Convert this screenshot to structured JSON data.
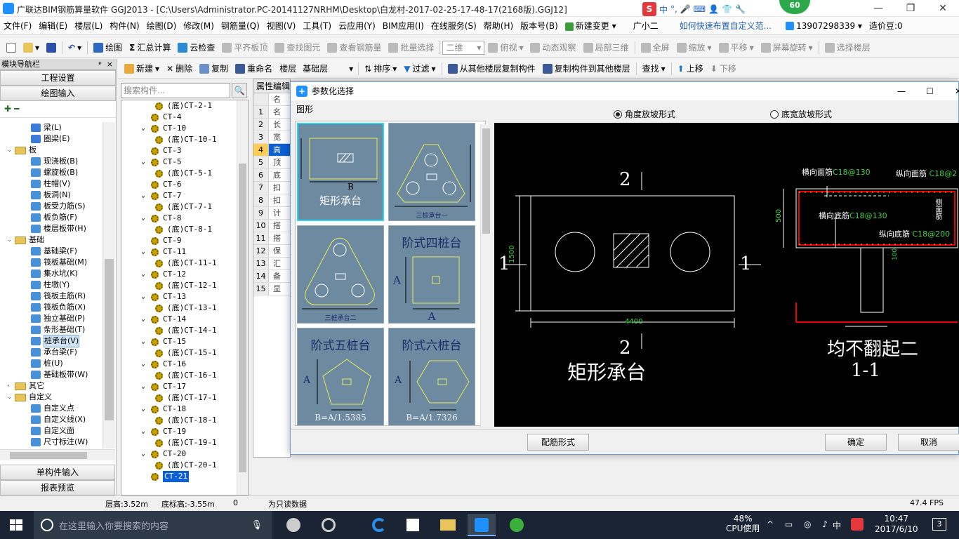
{
  "titlebar": {
    "title": "广联达BIM钢筋算量软件 GGJ2013 - [C:\\Users\\Administrator.PC-20141127NRHM\\Desktop\\白龙村-2017-02-25-17-48-17(2168版).GGJ12]",
    "ime": [
      "中",
      "°,",
      "🎤",
      "⌨",
      "👤",
      "👕",
      "🔧"
    ],
    "ime_badge": "S",
    "badge": "60",
    "min": "—",
    "max": "❐",
    "close": "✕"
  },
  "menus": [
    "文件(F)",
    "编辑(E)",
    "楼层(L)",
    "构件(N)",
    "绘图(D)",
    "修改(M)",
    "钢筋量(Q)",
    "视图(V)",
    "工具(T)",
    "云应用(Y)",
    "BIM应用(I)",
    "在线服务(S)",
    "帮助(H)",
    "版本号(B)",
    "新建变更",
    "广小二",
    "如何快速布置自定义范...",
    "13907298339",
    "造价豆:0"
  ],
  "toolbar1": {
    "items": [
      "绘图",
      "汇总计算",
      "云检查",
      "平齐板顶",
      "查找图元",
      "查看钢筋量",
      "批量选择"
    ],
    "view_combo": "二维",
    "view_items": [
      "俯视",
      "动态观察",
      "局部三维",
      "全屏",
      "缩放",
      "平移",
      "屏幕旋转",
      "选择楼层"
    ],
    "sigma": "Σ"
  },
  "toolbar2": {
    "items": [
      "新建",
      "删除",
      "复制",
      "重命名",
      "楼层",
      "排序",
      "过滤",
      "从其他楼层复制构件",
      "复制构件到其他楼层",
      "查找",
      "上移",
      "下移"
    ],
    "floor_combo": "基础层"
  },
  "nav": {
    "header": "模块导航栏",
    "pin": "ᵖ",
    "close": "×",
    "btn_setup": "工程设置",
    "btn_draw": "绘图输入",
    "btn_single": "单构件输入",
    "btn_report": "报表预览",
    "tools": "+ -",
    "tree": [
      {
        "t": "梁(L)",
        "lvl": 2,
        "c": "#3a7bd5"
      },
      {
        "t": "圈梁(E)",
        "lvl": 2,
        "c": "#3a7bd5"
      },
      {
        "t": "板",
        "lvl": 1,
        "fold": true,
        "exp": "⌄"
      },
      {
        "t": "现浇板(B)",
        "lvl": 2,
        "c": "#4a90d9"
      },
      {
        "t": "螺旋板(B)",
        "lvl": 2,
        "c": "#4a90d9"
      },
      {
        "t": "柱帽(V)",
        "lvl": 2,
        "c": "#4a90d9"
      },
      {
        "t": "板洞(N)",
        "lvl": 2,
        "c": "#4a90d9"
      },
      {
        "t": "板受力筋(S)",
        "lvl": 2,
        "c": "#4a90d9"
      },
      {
        "t": "板负筋(F)",
        "lvl": 2,
        "c": "#4a90d9"
      },
      {
        "t": "楼层板带(H)",
        "lvl": 2,
        "c": "#4a90d9"
      },
      {
        "t": "基础",
        "lvl": 1,
        "fold": true,
        "exp": "⌄"
      },
      {
        "t": "基础梁(F)",
        "lvl": 2,
        "c": "#4a90d9"
      },
      {
        "t": "筏板基础(M)",
        "lvl": 2,
        "c": "#4a90d9"
      },
      {
        "t": "集水坑(K)",
        "lvl": 2,
        "c": "#4a90d9"
      },
      {
        "t": "柱墩(Y)",
        "lvl": 2,
        "c": "#4a90d9"
      },
      {
        "t": "筏板主筋(R)",
        "lvl": 2,
        "c": "#4a90d9"
      },
      {
        "t": "筏板负筋(X)",
        "lvl": 2,
        "c": "#4a90d9"
      },
      {
        "t": "独立基础(P)",
        "lvl": 2,
        "c": "#4a90d9"
      },
      {
        "t": "条形基础(T)",
        "lvl": 2,
        "c": "#4a90d9"
      },
      {
        "t": "桩承台(V)",
        "lvl": 2,
        "c": "#4a90d9",
        "sel": true
      },
      {
        "t": "承台梁(F)",
        "lvl": 2,
        "c": "#4a90d9"
      },
      {
        "t": "桩(U)",
        "lvl": 2,
        "c": "#4a90d9"
      },
      {
        "t": "基础板带(W)",
        "lvl": 2,
        "c": "#4a90d9"
      },
      {
        "t": "其它",
        "lvl": 1,
        "fold": true,
        "exp": "›"
      },
      {
        "t": "自定义",
        "lvl": 1,
        "fold": true,
        "exp": "⌄"
      },
      {
        "t": "自定义点",
        "lvl": 2,
        "c": "#4a90d9"
      },
      {
        "t": "自定义线(X)",
        "lvl": 2,
        "c": "#4a90d9"
      },
      {
        "t": "自定义面",
        "lvl": 2,
        "c": "#4a90d9"
      },
      {
        "t": "尺寸标注(W)",
        "lvl": 2,
        "c": "#4a90d9"
      }
    ]
  },
  "search": {
    "placeholder": "搜索构件...",
    "icon": "🔍"
  },
  "components": [
    {
      "t": "(底)CT-2-1",
      "sub": true
    },
    {
      "t": "CT-4"
    },
    {
      "t": "CT-10",
      "exp": true
    },
    {
      "t": "(底)CT-10-1",
      "sub": true
    },
    {
      "t": "CT-3"
    },
    {
      "t": "CT-5",
      "exp": true
    },
    {
      "t": "(底)CT-5-1",
      "sub": true
    },
    {
      "t": "CT-6"
    },
    {
      "t": "CT-7",
      "exp": true
    },
    {
      "t": "(底)CT-7-1",
      "sub": true
    },
    {
      "t": "CT-8",
      "exp": true
    },
    {
      "t": "(底)CT-8-1",
      "sub": true
    },
    {
      "t": "CT-9"
    },
    {
      "t": "CT-11",
      "exp": true
    },
    {
      "t": "(底)CT-11-1",
      "sub": true
    },
    {
      "t": "CT-12",
      "exp": true
    },
    {
      "t": "(底)CT-12-1",
      "sub": true
    },
    {
      "t": "CT-13",
      "exp": true
    },
    {
      "t": "(底)CT-13-1",
      "sub": true
    },
    {
      "t": "CT-14",
      "exp": true
    },
    {
      "t": "(底)CT-14-1",
      "sub": true
    },
    {
      "t": "CT-15",
      "exp": true
    },
    {
      "t": "(底)CT-15-1",
      "sub": true
    },
    {
      "t": "CT-16",
      "exp": true
    },
    {
      "t": "(底)CT-16-1",
      "sub": true
    },
    {
      "t": "CT-17",
      "exp": true
    },
    {
      "t": "(底)CT-17-1",
      "sub": true
    },
    {
      "t": "CT-18",
      "exp": true
    },
    {
      "t": "(底)CT-18-1",
      "sub": true
    },
    {
      "t": "CT-19",
      "exp": true
    },
    {
      "t": "(底)CT-19-1",
      "sub": true
    },
    {
      "t": "CT-20",
      "exp": true
    },
    {
      "t": "(底)CT-20-1",
      "sub": true
    },
    {
      "t": "CT-21",
      "sel": true
    }
  ],
  "props": {
    "header": "属性编辑",
    "rows": [
      {
        "n": "",
        "v": "名"
      },
      {
        "n": "1",
        "v": "名"
      },
      {
        "n": "2",
        "v": "长"
      },
      {
        "n": "3",
        "v": "宽"
      },
      {
        "n": "4",
        "v": "高",
        "sel": true
      },
      {
        "n": "5",
        "v": "顶"
      },
      {
        "n": "6",
        "v": "底"
      },
      {
        "n": "7",
        "v": "扣"
      },
      {
        "n": "8",
        "v": "扣"
      },
      {
        "n": "9",
        "v": "计"
      },
      {
        "n": "10",
        "v": "搭"
      },
      {
        "n": "11",
        "v": "搭"
      },
      {
        "n": "12",
        "v": "保"
      },
      {
        "n": "13",
        "v": "汇"
      },
      {
        "n": "14",
        "v": "备"
      },
      {
        "n": "15",
        "v": "显"
      }
    ]
  },
  "dialog": {
    "title": "参数化选择",
    "icon": "+",
    "gallery_label": "图形",
    "radio1": "角度放坡形式",
    "radio2": "底宽放坡形式",
    "btn_rebar": "配筋形式",
    "btn_ok": "确定",
    "btn_cancel": "取消",
    "close": "✕",
    "max": "☐",
    "min": "—",
    "thumbs": [
      {
        "label": "矩形承台",
        "dim": "B"
      },
      {
        "label": "三桩承台一",
        "dim": ""
      },
      {
        "label": "三桩承台二",
        "dim": ""
      },
      {
        "label": "阶式四桩台",
        "dim": "A"
      },
      {
        "label": "阶式五桩台",
        "dim": "B=A/1.5385"
      },
      {
        "label": "阶式六桩台",
        "dim": "B=A/1.7326"
      }
    ],
    "preview": {
      "sec_top": "2",
      "sec_bot": "2",
      "sec_left": "1",
      "sec_right": "1",
      "dim_w": "4400",
      "dim_h": "1500",
      "caption": "矩形承台",
      "rebar_top": "横向面筋",
      "rebar_top_v": "C18@130",
      "rebar_top2": "纵向面筋",
      "rebar_top2_v": "C18@2",
      "rebar_bot": "横向底筋",
      "rebar_bot_v": "C18@130",
      "rebar_bot2": "纵向底筋",
      "rebar_bot2_v": "C18@200",
      "side": "侧面筋",
      "h500": "500",
      "h100": "100",
      "note": "均不翻起二",
      "sec_label": "1-1"
    }
  },
  "status": {
    "floor_h": "层高:3.52m",
    "base_h": "底标高:-3.55m",
    "zero": "0",
    "readonly": "为只读数据",
    "fps": "47.4 FPS"
  },
  "taskbar": {
    "search": "在这里输入你要搜索的内容",
    "cpu_pct": "48%",
    "cpu": "CPU使用",
    "lang": "中",
    "time": "10:47",
    "date": "2017/6/10",
    "notif": "3",
    "mic": "🎙",
    "tray_icons": "^ ▭ ◎ ♪"
  }
}
